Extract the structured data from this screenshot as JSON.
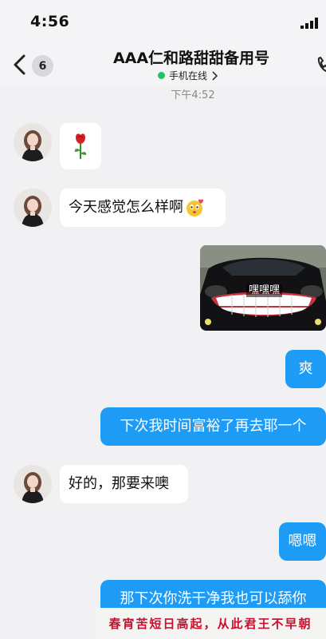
{
  "status_bar": {
    "time": "4:56"
  },
  "header": {
    "unread_count": "6",
    "contact_name": "AAA仁和路甜甜备用号",
    "online_status": "手机在线"
  },
  "chat": {
    "time_divider": "下午4:52",
    "messages": [
      {
        "direction": "in",
        "type": "emoji",
        "content": "rose-emoji"
      },
      {
        "direction": "in",
        "type": "text",
        "text": "今天感觉怎么样啊"
      },
      {
        "direction": "out",
        "type": "image",
        "caption": "嘿嘿嘿"
      },
      {
        "direction": "out",
        "type": "text",
        "text": "爽"
      },
      {
        "direction": "out",
        "type": "text",
        "text": "下次我时间富裕了再去耶一个"
      },
      {
        "direction": "in",
        "type": "text",
        "text": "好的，那要来噢"
      },
      {
        "direction": "out",
        "type": "text",
        "text": "嗯嗯"
      },
      {
        "direction": "out",
        "type": "text",
        "text": "那下次你洗干净我也可以舔你"
      }
    ]
  },
  "overlay_banner": {
    "text": "春宵苦短日高起，从此君王不早朝"
  },
  "colors": {
    "background": "#f1f1f3",
    "outgoing_bubble": "#1e9bf5",
    "incoming_bubble": "#ffffff",
    "online_dot": "#21c25f",
    "banner_text": "#c8102e"
  }
}
